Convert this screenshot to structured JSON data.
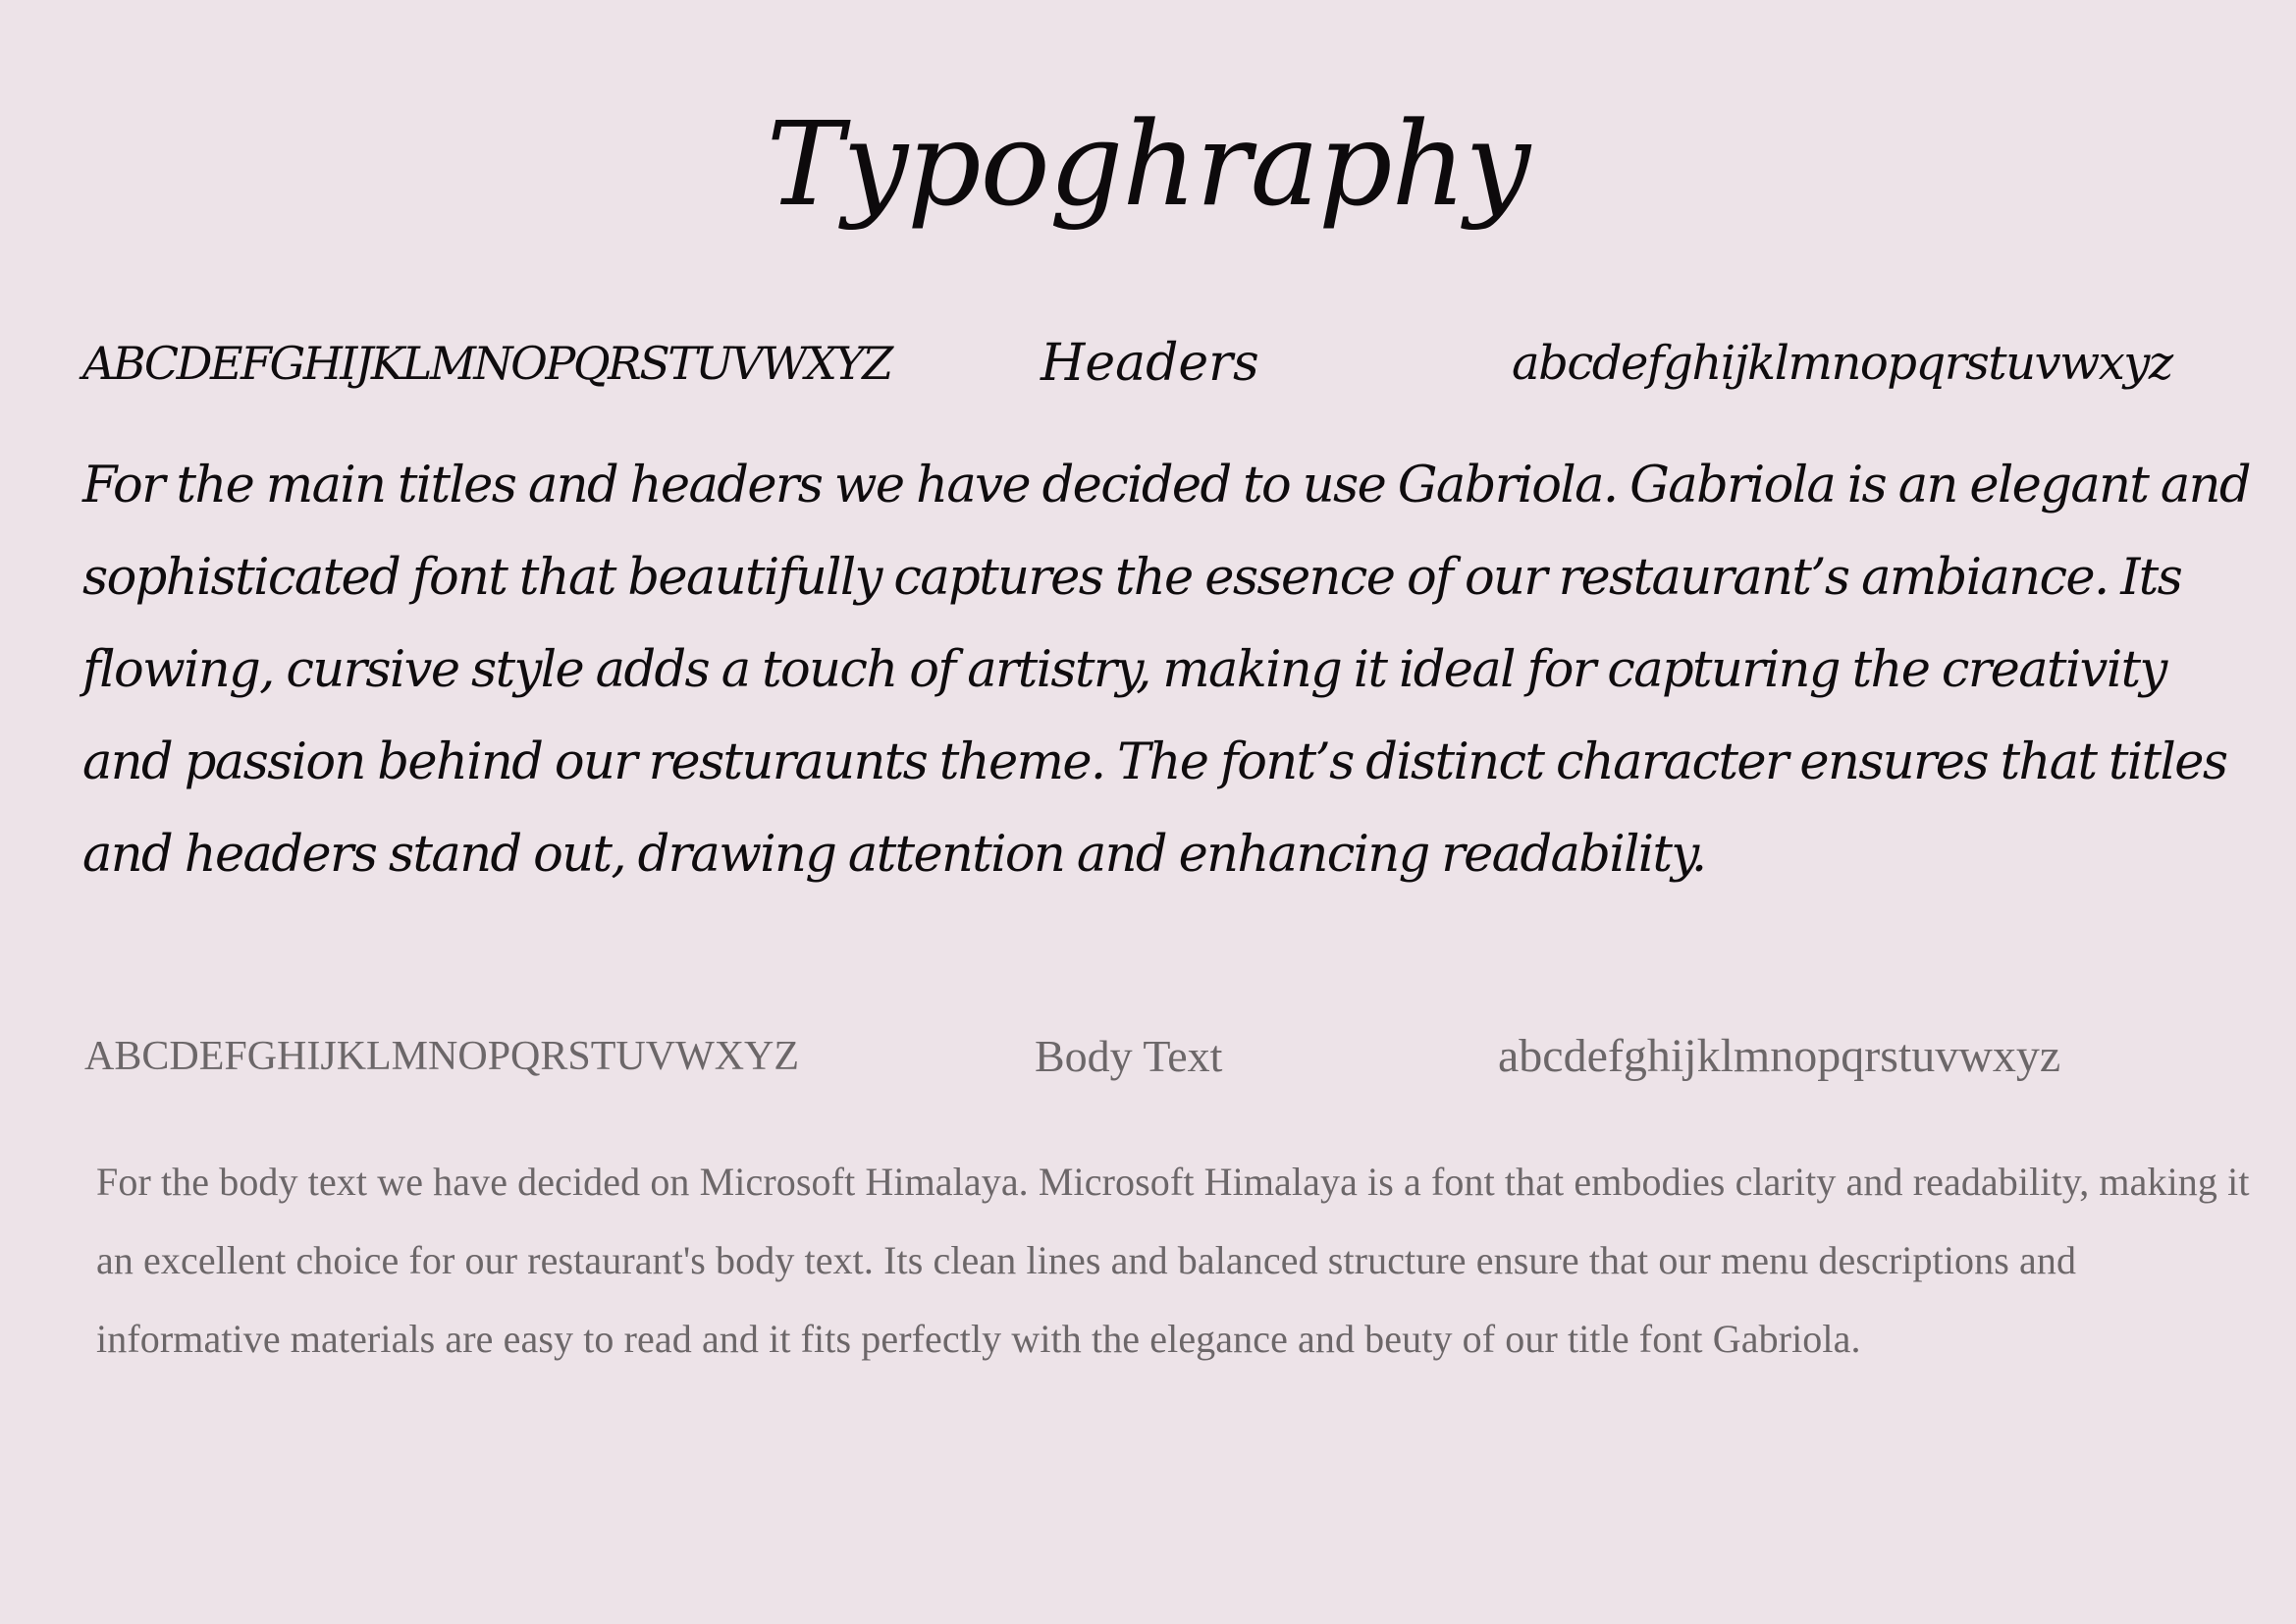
{
  "page": {
    "title": "Typoghraphy",
    "background_color": "#ede3e8"
  },
  "header_font": {
    "uppercase_sample": "ABCDEFGHIJKLMNOPQRSTUVWXYZ",
    "label": "Headers",
    "lowercase_sample": "abcdefghijklmnopqrstuvwxyz",
    "description": "For the main titles and headers we have decided to use Gabriola. Gabriola is an elegant and sophisticated font that beautifully captures the essence of our restaurant’s ambiance. Its flowing, cursive style adds a touch of artistry, making it ideal for capturing the creativity and passion behind our resturaunts theme. The font’s distinct character ensures that titles and headers stand out, drawing attention and enhancing readability.",
    "text_color": "#0f0c0e"
  },
  "body_font": {
    "uppercase_sample": "ABCDEFGHIJKLMNOPQRSTUVWXYZ",
    "label": "Body Text",
    "lowercase_sample": "abcdefghijklmnopqrstuvwxyz",
    "description": "For the body text we have decided on Microsoft Himalaya. Microsoft Himalaya is a font that embodies clarity and readability, making it an excellent choice for our restaurant's body text. Its clean lines and balanced structure ensure that our menu descriptions and informative materials are easy to read and it fits perfectly with the elegance and beuty of our title font Gabriola.",
    "text_color": "#6c6769"
  }
}
